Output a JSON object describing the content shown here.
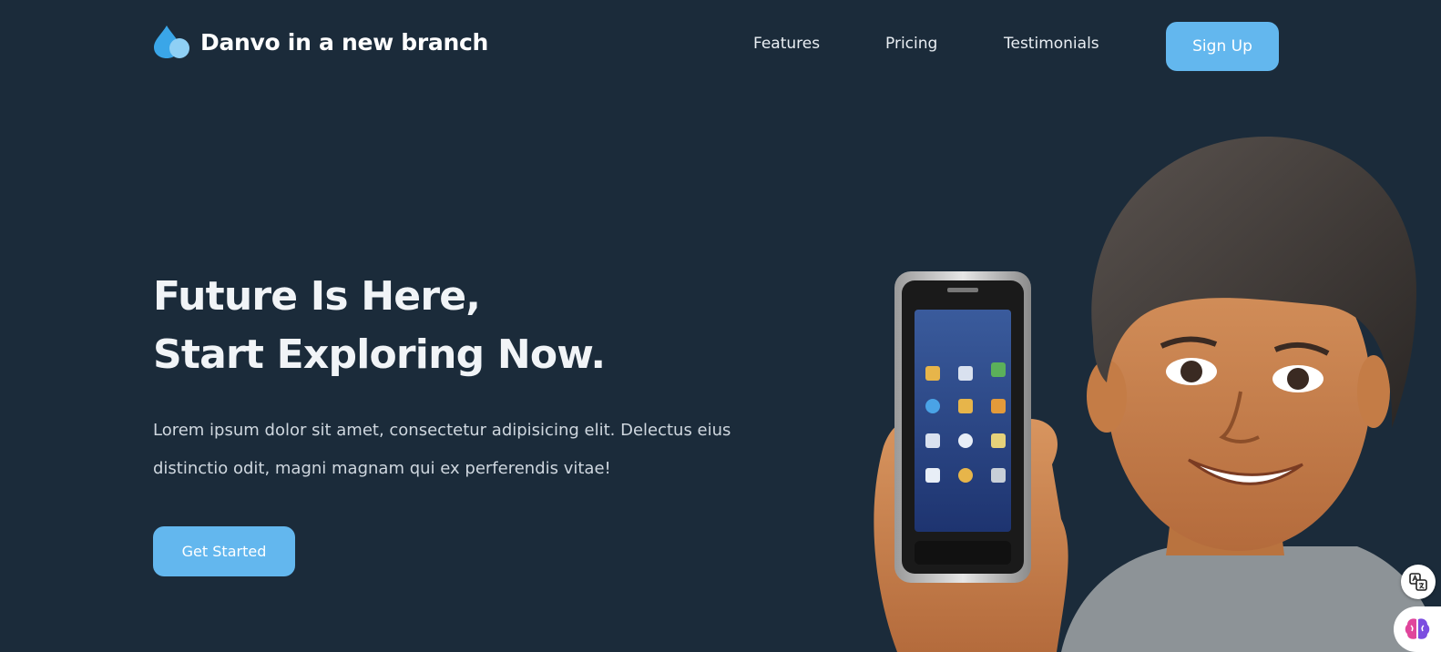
{
  "header": {
    "brand": "Danvo in a new branch",
    "nav": {
      "features": "Features",
      "pricing": "Pricing",
      "testimonials": "Testimonials"
    },
    "signup_label": "Sign Up"
  },
  "hero": {
    "title_line1": "Future Is Here,",
    "title_line2": "Start Exploring Now.",
    "description": "Lorem ipsum dolor sit amet, consectetur adipisicing elit. Delectus eius distinctio odit, magni magnam qui ex perferendis vitae!",
    "cta_label": "Get Started",
    "illustration": "boy-holding-smartphone-illustration"
  },
  "floating": {
    "translate_icon": "translate-icon",
    "brain_icon": "brain-icon"
  },
  "colors": {
    "background": "#1b2b3a",
    "accent": "#63b7ee",
    "text": "#ffffff",
    "muted_text": "#cfd7df"
  }
}
